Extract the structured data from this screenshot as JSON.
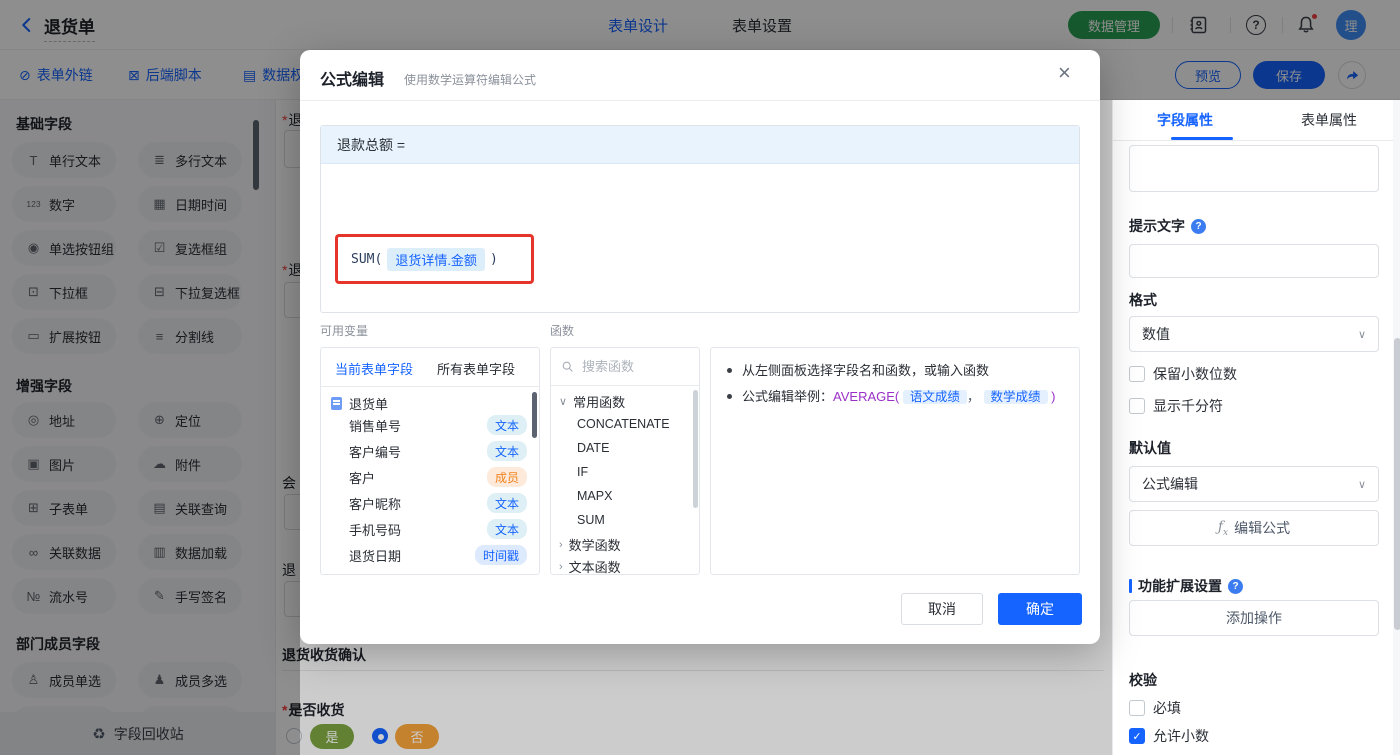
{
  "topbar": {
    "title": "退货单",
    "tab_design": "表单设计",
    "tab_settings": "表单设置",
    "data_manage": "数据管理",
    "avatar": "理"
  },
  "toolbar": {
    "form_link": "表单外链",
    "backend_script": "后端脚本",
    "data_perm": "数据权",
    "preview": "预览",
    "save": "保存"
  },
  "sidebar": {
    "sections": [
      {
        "title": "基础字段",
        "items": [
          {
            "icon": "T",
            "label": "单行文本"
          },
          {
            "icon": "≣",
            "label": "多行文本"
          },
          {
            "icon": "123",
            "label": "数字"
          },
          {
            "icon": "▦",
            "label": "日期时间"
          },
          {
            "icon": "◉",
            "label": "单选按钮组"
          },
          {
            "icon": "☑",
            "label": "复选框组"
          },
          {
            "icon": "⊡",
            "label": "下拉框"
          },
          {
            "icon": "⊟",
            "label": "下拉复选框"
          },
          {
            "icon": "▭",
            "label": "扩展按钮"
          },
          {
            "icon": "≡",
            "label": "分割线"
          }
        ]
      },
      {
        "title": "增强字段",
        "items": [
          {
            "icon": "◎",
            "label": "地址"
          },
          {
            "icon": "⊕",
            "label": "定位"
          },
          {
            "icon": "▣",
            "label": "图片"
          },
          {
            "icon": "☁",
            "label": "附件"
          },
          {
            "icon": "⊞",
            "label": "子表单"
          },
          {
            "icon": "▤",
            "label": "关联查询"
          },
          {
            "icon": "∞",
            "label": "关联数据"
          },
          {
            "icon": "▥",
            "label": "数据加载"
          },
          {
            "icon": "№",
            "label": "流水号"
          },
          {
            "icon": "✎",
            "label": "手写签名"
          }
        ]
      },
      {
        "title": "部门成员字段",
        "items": [
          {
            "icon": "♙",
            "label": "成员单选"
          },
          {
            "icon": "♟",
            "label": "成员多选"
          }
        ]
      }
    ],
    "recycle": "字段回收站"
  },
  "canvas": {
    "required_mark": "*",
    "stub_label_1": "退",
    "stub_label_2": "退",
    "stub_label_3": "会",
    "stub_label_4": "退",
    "section_title": "退货收货确认",
    "question": "是否收货",
    "option_yes": "是",
    "option_no": "否"
  },
  "modal": {
    "title": "公式编辑",
    "subtitle": "使用数学运算符编辑公式",
    "target": "退款总额 =",
    "formula": {
      "fn": "SUM(",
      "field": "退货详情.金额",
      "close": ")"
    },
    "vars": {
      "label": "可用变量",
      "tab_current": "当前表单字段",
      "tab_all": "所有表单字段",
      "root": "退货单",
      "fields": [
        {
          "name": "销售单号",
          "type": "文本"
        },
        {
          "name": "客户编号",
          "type": "文本"
        },
        {
          "name": "客户",
          "type": "成员"
        },
        {
          "name": "客户昵称",
          "type": "文本"
        },
        {
          "name": "手机号码",
          "type": "文本"
        },
        {
          "name": "退货日期",
          "type": "时间戳"
        }
      ]
    },
    "funcs": {
      "label": "函数",
      "search_placeholder": "搜索函数",
      "group_common": "常用函数",
      "items": [
        "CONCATENATE",
        "DATE",
        "IF",
        "MAPX",
        "SUM"
      ],
      "group_math": "数学函数",
      "group_text": "文本函数"
    },
    "tips": {
      "line1": "从左侧面板选择字段名和函数，或输入函数",
      "line2_prefix": "公式编辑举例：",
      "fn": "AVERAGE(",
      "arg1": "语文成绩",
      "comma": "，",
      "arg2": "数学成绩",
      "close": ")"
    },
    "cancel": "取消",
    "ok": "确定"
  },
  "panel": {
    "tab_field": "字段属性",
    "tab_form": "表单属性",
    "hint_label": "提示文字",
    "format_label": "格式",
    "format_value": "数值",
    "cb_keep_decimal": "保留小数位数",
    "cb_thousand": "显示千分符",
    "default_label": "默认值",
    "default_value": "公式编辑",
    "edit_formula": "编辑公式",
    "ext_label": "功能扩展设置",
    "add_action": "添加操作",
    "validate_label": "校验",
    "cb_required": "必填",
    "cb_allow_decimal": "允许小数"
  }
}
